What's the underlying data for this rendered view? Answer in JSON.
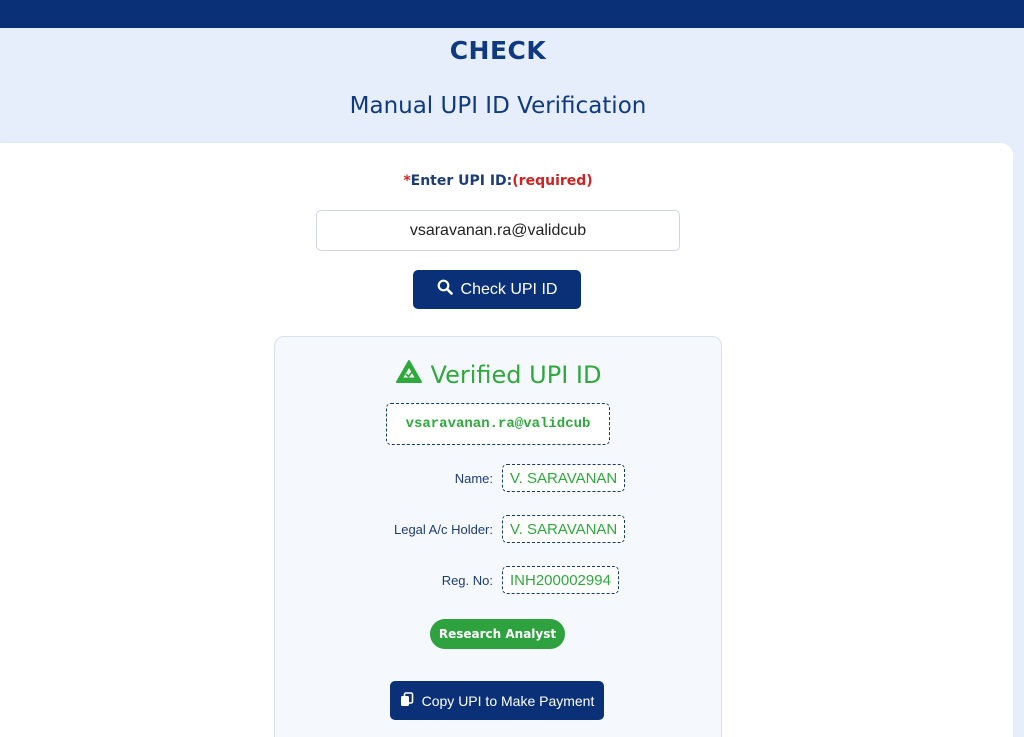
{
  "header": {
    "brand": "CHECK",
    "subtitle": "Manual UPI ID Verification"
  },
  "form": {
    "label_star": "*",
    "label_text": "Enter UPI ID:",
    "label_required": "(required)",
    "upi_value": "vsaravanan.ra@validcub",
    "check_button_label": "Check UPI ID",
    "check_button_icon": "search-icon"
  },
  "result": {
    "title": "Verified UPI ID",
    "title_icon": "verified-triangle-icon",
    "upi": "vsaravanan.ra@validcub",
    "name_label": "Name:",
    "name_value": "V. SARAVANAN",
    "holder_label": "Legal A/c Holder:",
    "holder_value": "V. SARAVANAN",
    "reg_label": "Reg. No:",
    "reg_value": "INH200002994",
    "badge": "Research Analyst",
    "copy_button_label": "Copy UPI to Make Payment",
    "copy_button_icon": "copy-icon"
  },
  "colors": {
    "navy": "#0a3178",
    "verified_green": "#2eaa3d",
    "required_red": "#d42020",
    "page_bg": "#e7eefb"
  }
}
